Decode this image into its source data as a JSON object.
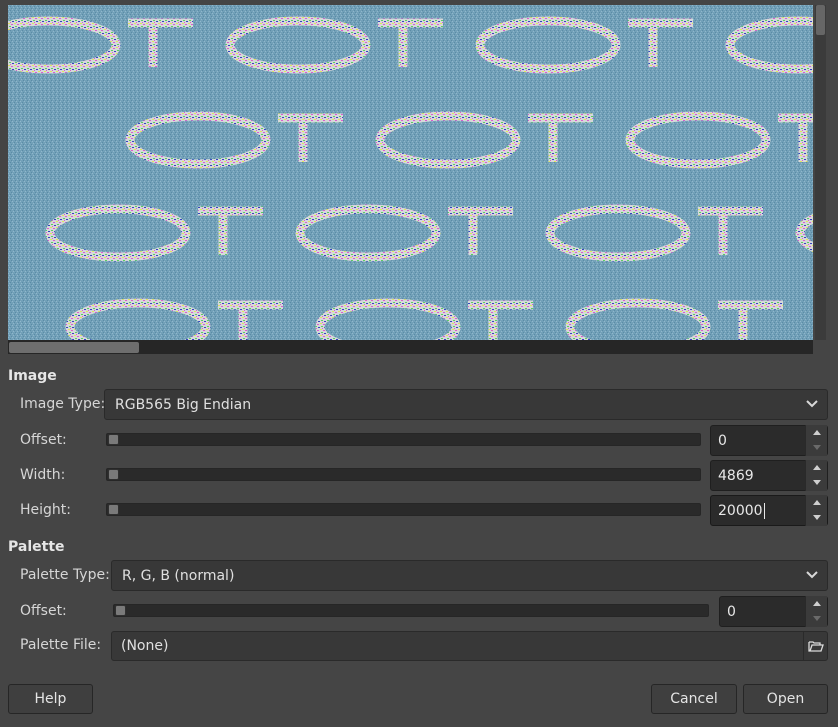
{
  "preview": {
    "background_color": "#72a0b8",
    "glyph_colors": [
      "#e8e85a",
      "#e05ad0",
      "#5ad060",
      "#ffffff",
      "#3040c0"
    ]
  },
  "image": {
    "section_title": "Image",
    "type_label": "Image Type:",
    "type_value": "RGB565 Big Endian",
    "offset_label": "Offset:",
    "offset_value": "0",
    "width_label": "Width:",
    "width_value": "4869",
    "height_label": "Height:",
    "height_value": "20000"
  },
  "palette": {
    "section_title": "Palette",
    "type_label": "Palette Type:",
    "type_value": "R, G, B (normal)",
    "offset_label": "Offset:",
    "offset_value": "0",
    "file_label": "Palette File:",
    "file_value": "(None)"
  },
  "buttons": {
    "help": "Help",
    "cancel": "Cancel",
    "open": "Open"
  },
  "icons": {
    "combo": "chevron-down-icon",
    "spin_up": "arrow-up-icon",
    "spin_down": "arrow-down-icon",
    "file": "folder-open-icon"
  }
}
